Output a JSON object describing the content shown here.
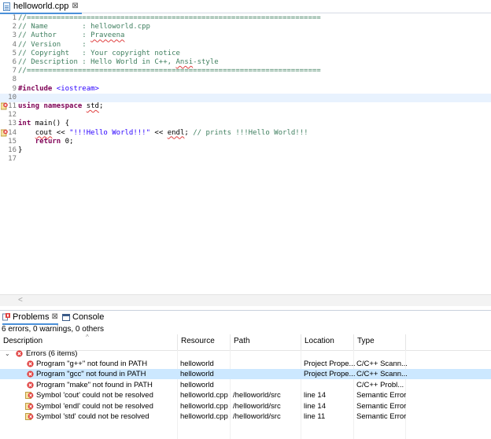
{
  "editor": {
    "tab": {
      "label": "helloworld.cpp",
      "close": "⊠"
    },
    "lines": [
      {
        "n": "1",
        "parts": [
          {
            "t": "//=====================================================================",
            "c": "comment"
          }
        ]
      },
      {
        "n": "2",
        "parts": [
          {
            "t": "// Name        : helloworld.cpp",
            "c": "comment"
          }
        ]
      },
      {
        "n": "3",
        "parts": [
          {
            "t": "// Author      : ",
            "c": "comment"
          },
          {
            "t": "Praveena",
            "c": "name-squig"
          }
        ]
      },
      {
        "n": "4",
        "parts": [
          {
            "t": "// Version     :",
            "c": "comment"
          }
        ]
      },
      {
        "n": "5",
        "parts": [
          {
            "t": "// Copyright   : Your copyright notice",
            "c": "comment"
          }
        ]
      },
      {
        "n": "6",
        "parts": [
          {
            "t": "// Description : Hello World in C++, ",
            "c": "comment"
          },
          {
            "t": "Ansi",
            "c": "name-squig"
          },
          {
            "t": "-style",
            "c": "comment"
          }
        ]
      },
      {
        "n": "7",
        "parts": [
          {
            "t": "//=====================================================================",
            "c": "comment"
          }
        ]
      },
      {
        "n": "8",
        "parts": []
      },
      {
        "n": "9",
        "parts": [
          {
            "t": "#include",
            "c": "pre"
          },
          {
            "t": " ",
            "c": "def"
          },
          {
            "t": "<iostream>",
            "c": "inc"
          }
        ]
      },
      {
        "n": "10",
        "parts": [],
        "current": true
      },
      {
        "n": "11",
        "parts": [
          {
            "t": "using",
            "c": "kw"
          },
          {
            "t": " ",
            "c": "def"
          },
          {
            "t": "namespace",
            "c": "kw"
          },
          {
            "t": " ",
            "c": "def"
          },
          {
            "t": "std",
            "c": "squig"
          },
          {
            "t": ";",
            "c": "def"
          }
        ],
        "marker": true
      },
      {
        "n": "12",
        "parts": []
      },
      {
        "n": "13",
        "parts": [
          {
            "t": "int",
            "c": "kw"
          },
          {
            "t": " main() {",
            "c": "def"
          }
        ]
      },
      {
        "n": "14",
        "parts": [
          {
            "t": "    ",
            "c": "def"
          },
          {
            "t": "cout",
            "c": "squig"
          },
          {
            "t": " << ",
            "c": "def"
          },
          {
            "t": "\"!!!Hello World!!!\"",
            "c": "str"
          },
          {
            "t": " << ",
            "c": "def"
          },
          {
            "t": "endl",
            "c": "squig"
          },
          {
            "t": "; ",
            "c": "def"
          },
          {
            "t": "// prints !!!Hello World!!!",
            "c": "comment"
          }
        ],
        "marker": true
      },
      {
        "n": "15",
        "parts": [
          {
            "t": "    ",
            "c": "def"
          },
          {
            "t": "return",
            "c": "kw"
          },
          {
            "t": " 0;",
            "c": "def"
          }
        ]
      },
      {
        "n": "16",
        "parts": [
          {
            "t": "}",
            "c": "def"
          }
        ]
      },
      {
        "n": "17",
        "parts": []
      }
    ],
    "scroll_arrow": "<"
  },
  "problems_view": {
    "tabs": [
      {
        "label": "Problems",
        "close": "⊠",
        "icon": "problems-icon"
      },
      {
        "label": "Console",
        "icon": "console-icon"
      }
    ],
    "summary": "6 errors, 0 warnings, 0 others",
    "columns": [
      "Description",
      "Resource",
      "Path",
      "Location",
      "Type"
    ],
    "group": {
      "label": "Errors (6 items)",
      "twisty": "⌄"
    },
    "rows": [
      {
        "icon": "error",
        "description": "Program \"g++\" not found in PATH",
        "resource": "helloworld",
        "path": "",
        "location": "Project Prope...",
        "type": "C/C++ Scann..."
      },
      {
        "icon": "error",
        "description": "Program \"gcc\" not found in PATH",
        "resource": "helloworld",
        "path": "",
        "location": "Project Prope...",
        "type": "C/C++ Scann...",
        "selected": true
      },
      {
        "icon": "error",
        "description": "Program \"make\" not found in PATH",
        "resource": "helloworld",
        "path": "",
        "location": "",
        "type": "C/C++ Probl..."
      },
      {
        "icon": "semantic",
        "description": "Symbol 'cout' could not be resolved",
        "resource": "helloworld.cpp",
        "path": "/helloworld/src",
        "location": "line 14",
        "type": "Semantic Error"
      },
      {
        "icon": "semantic",
        "description": "Symbol 'endl' could not be resolved",
        "resource": "helloworld.cpp",
        "path": "/helloworld/src",
        "location": "line 14",
        "type": "Semantic Error"
      },
      {
        "icon": "semantic",
        "description": "Symbol 'std' could not be resolved",
        "resource": "helloworld.cpp",
        "path": "/helloworld/src",
        "location": "line 11",
        "type": "Semantic Error"
      }
    ]
  },
  "colors": {
    "comment": "#3f7f5f",
    "keyword": "#7f0055",
    "string": "#2a00ff",
    "selection": "#cce8ff",
    "error": "#e04040"
  }
}
